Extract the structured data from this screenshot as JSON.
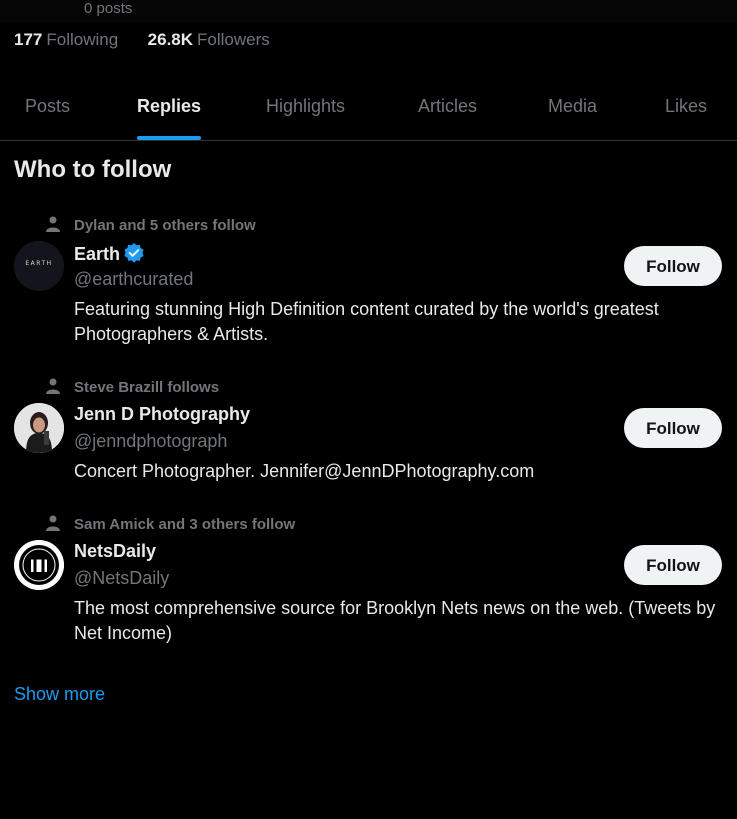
{
  "profile": {
    "posts_count": "0 posts",
    "following_count": "177",
    "following_label": "Following",
    "followers_count": "26.8K",
    "followers_label": "Followers"
  },
  "tabs": [
    {
      "label": "Posts",
      "active": false
    },
    {
      "label": "Replies",
      "active": true
    },
    {
      "label": "Highlights",
      "active": false
    },
    {
      "label": "Articles",
      "active": false
    },
    {
      "label": "Media",
      "active": false
    },
    {
      "label": "Likes",
      "active": false
    }
  ],
  "who_to_follow": {
    "title": "Who to follow",
    "show_more": "Show more",
    "accounts": [
      {
        "social_context": "Dylan and 5 others follow",
        "name": "Earth",
        "verified": true,
        "handle": "@earthcurated",
        "bio": "Featuring stunning High Definition content curated by the world's greatest Photographers & Artists.",
        "avatar_text": "EARTH",
        "follow_label": "Follow"
      },
      {
        "social_context": "Steve Brazill follows",
        "name": "Jenn D Photography",
        "verified": false,
        "handle": "@jenndphotograph",
        "bio": "Concert Photographer. Jennifer@JennDPhotography.com",
        "follow_label": "Follow"
      },
      {
        "social_context": "Sam Amick and 3 others follow",
        "name": "NetsDaily",
        "verified": false,
        "handle": "@NetsDaily",
        "bio": "The most comprehensive source for Brooklyn Nets news on the web. (Tweets by Net Income)",
        "follow_label": "Follow"
      }
    ]
  },
  "colors": {
    "background": "#000000",
    "accent": "#1d9bf0",
    "text_primary": "#e7e9ea",
    "text_secondary": "#71767b",
    "follow_button": "#eff3f4"
  },
  "icons": [
    "person-icon",
    "verified-badge-icon"
  ]
}
